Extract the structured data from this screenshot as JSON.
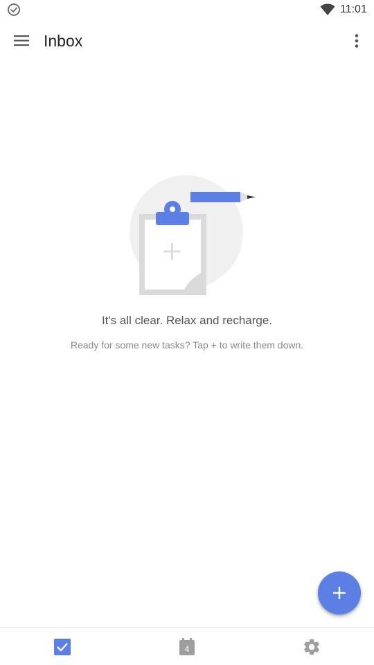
{
  "status_bar": {
    "time": "11:01",
    "left_icon": "check-circle-icon",
    "wifi_icon": "wifi-icon"
  },
  "app_bar": {
    "title": "Inbox",
    "menu_icon": "menu-icon",
    "overflow_icon": "more-vert-icon"
  },
  "empty_state": {
    "title": "It's all clear. Relax and recharge.",
    "subtitle": "Ready for some new tasks? Tap + to write them down.",
    "illustration": "clipboard-pencil-illustration"
  },
  "fab": {
    "icon": "plus-icon",
    "color": "#5c7fe6"
  },
  "bottom_nav": {
    "items": [
      {
        "name": "tasks",
        "icon": "checkbox-icon",
        "active": true
      },
      {
        "name": "calendar",
        "icon": "calendar-icon",
        "badge": "4",
        "active": false
      },
      {
        "name": "settings",
        "icon": "gear-icon",
        "active": false
      }
    ]
  },
  "colors": {
    "accent": "#5c7fe6",
    "inactive_icon": "#9e9e9e"
  }
}
